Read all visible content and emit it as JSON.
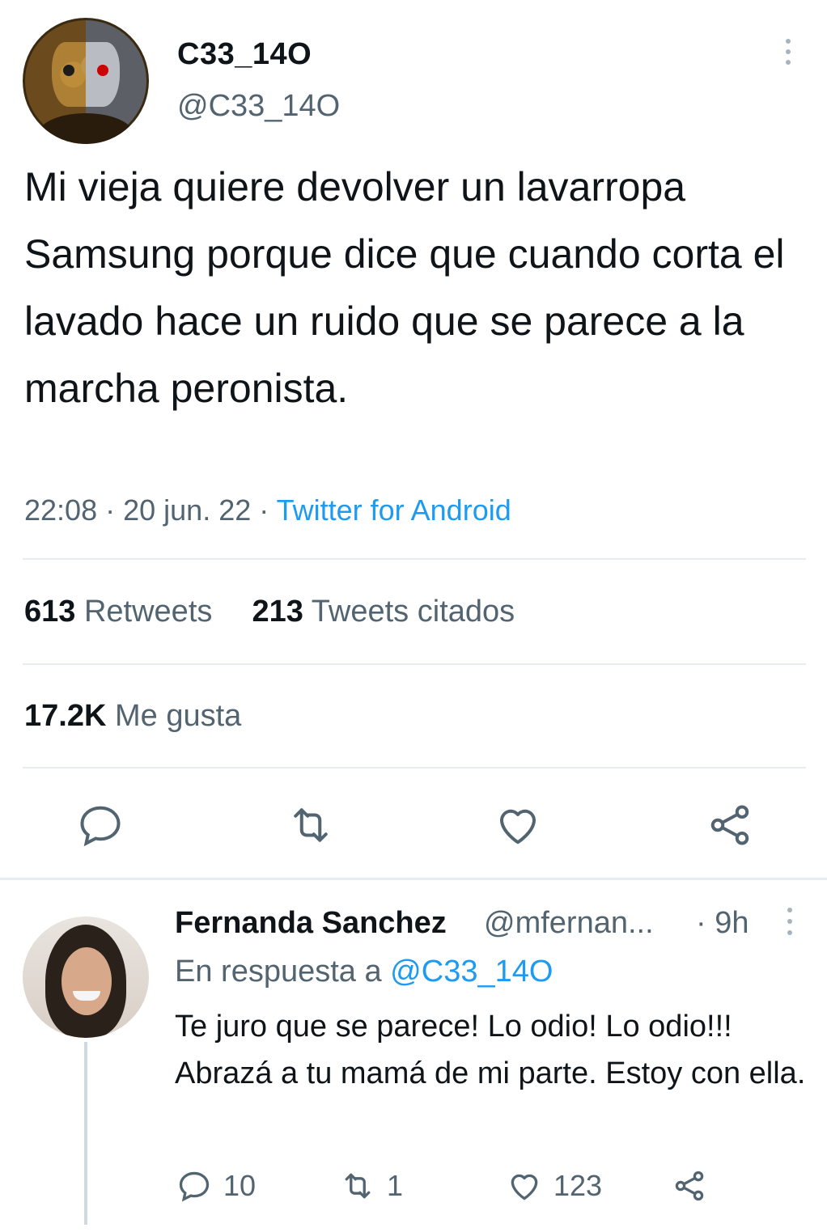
{
  "tweet": {
    "display_name": "C33_14O",
    "handle": "@C33_14O",
    "text": "Mi vieja quiere devolver un lavarropa Samsung porque dice que cuando corta el lavado hace un ruido que se parece a la marcha peronista.",
    "time": "22:08",
    "date": "20 jun. 22",
    "source": "Twitter for Android",
    "retweets_count": "613",
    "retweets_label": "Retweets",
    "quotes_count": "213",
    "quotes_label": "Tweets citados",
    "likes_count": "17.2K",
    "likes_label": "Me gusta",
    "icons": [
      "reply-icon",
      "retweet-icon",
      "like-icon",
      "share-icon",
      "more-icon"
    ]
  },
  "reply": {
    "display_name": "Fernanda Sanchez",
    "handle": "@mfernan...",
    "time": "· 9h",
    "reply_to_prefix": "En respuesta a",
    "reply_to_handle": "@C33_14O",
    "text": "Te juro que se parece! Lo odio! Lo odio!!! Abrazá a tu mamá de mi parte. Estoy con ella.",
    "reply_count": "10",
    "retweet_count": "1",
    "like_count": "123"
  },
  "colors": {
    "text": "#0f1419",
    "secondary": "#536471",
    "accent": "#1d9bf0",
    "divider": "#e6ecf0"
  }
}
